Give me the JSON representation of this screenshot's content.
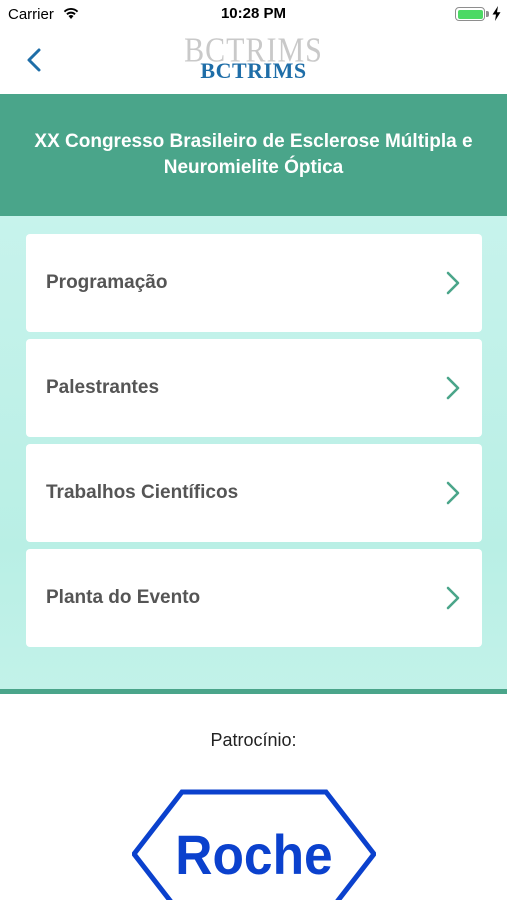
{
  "status_bar": {
    "carrier": "Carrier",
    "time": "10:28 PM",
    "battery_level": 1.0
  },
  "nav": {
    "logo_ghost_text": "BCTRIMS",
    "logo_text": "BCTRIMS"
  },
  "header": {
    "title": "XX Congresso Brasileiro de Esclerose Múltipla e Neuromielite Óptica"
  },
  "menu": {
    "items": [
      {
        "label": "Programação"
      },
      {
        "label": "Palestrantes"
      },
      {
        "label": "Trabalhos Científicos"
      },
      {
        "label": "Planta do Evento"
      }
    ]
  },
  "sponsor": {
    "label": "Patrocínio:",
    "brand": "Roche"
  },
  "colors": {
    "accent": "#4aa58a",
    "menu_bg": "#c7f3ec",
    "logo_blue": "#1f6ea8",
    "roche_blue": "#0b41cd",
    "label_gray": "#555555"
  }
}
